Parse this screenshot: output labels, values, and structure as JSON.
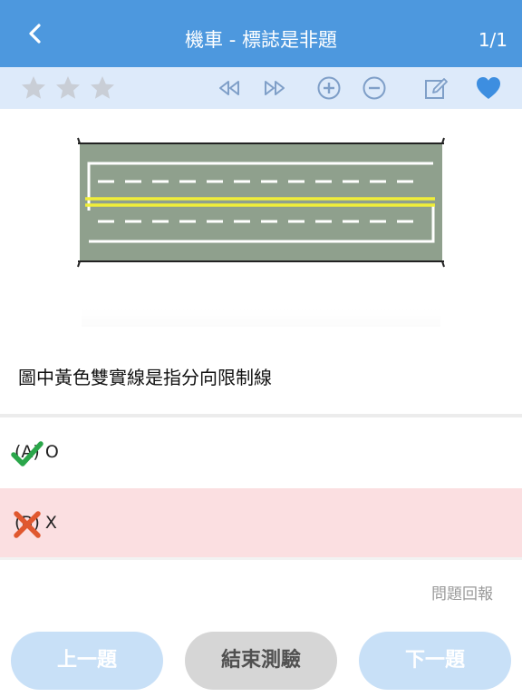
{
  "nav": {
    "title": "機車 - 標誌是非題",
    "counter": "1/1"
  },
  "toolbar": {
    "icons": [
      "star-icon",
      "star-icon",
      "star-icon",
      "rewind-icon",
      "fast-forward-icon",
      "zoom-in-icon",
      "zoom-out-icon",
      "edit-icon",
      "heart-icon"
    ],
    "colors": {
      "star": "#c9ced6",
      "control": "#7f9fc8",
      "heart": "#3d8ee0"
    }
  },
  "question": {
    "text": "圖中黃色雙實線是指分向限制線"
  },
  "options": [
    {
      "label": "(A) O",
      "status": "correct",
      "icon": "check-icon",
      "color": "#2aa64a"
    },
    {
      "label": "(B) X",
      "status": "wrong",
      "icon": "cross-icon",
      "color": "#e0582f"
    }
  ],
  "report": {
    "label": "問題回報"
  },
  "buttons": {
    "prev": "上一題",
    "end": "結束測驗",
    "next": "下一題"
  }
}
